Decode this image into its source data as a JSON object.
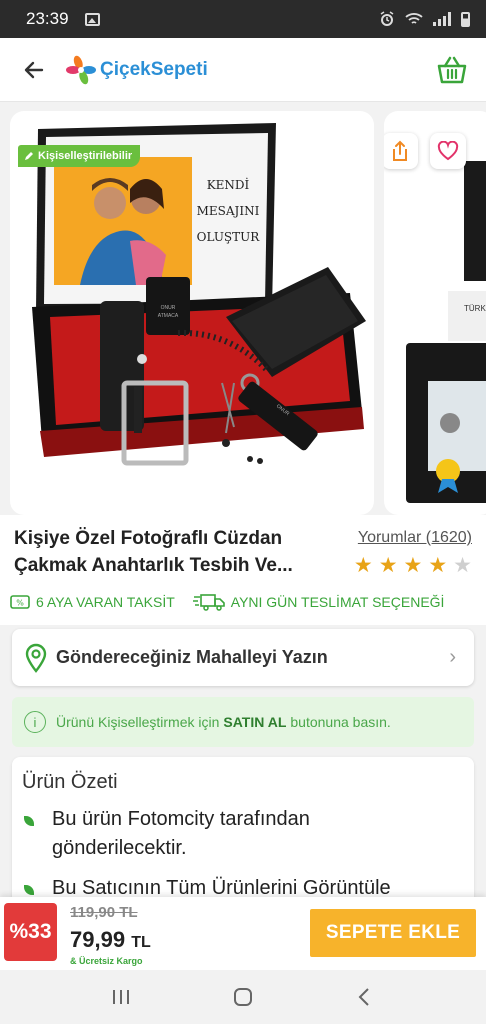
{
  "status_bar": {
    "time": "23:39"
  },
  "header": {
    "logo_text": "ÇiçekSepeti"
  },
  "gallery": {
    "badge": "Kişiselleştirilebilir",
    "card_lines": [
      "KENDİ",
      "MESAJINI",
      "OLUŞTUR"
    ],
    "engraving": [
      "ONUR",
      "ATMACA"
    ],
    "id_text": "TÜRKİ"
  },
  "product": {
    "title": "Kişiye Özel Fotoğraflı Cüzdan\nÇakmak Anahtarlık Tesbih Ve...",
    "reviews": "Yorumlar (1620)",
    "rating": 4,
    "rating_max": 5,
    "tag_installment": "6 AYA VARAN TAKSİT",
    "tag_delivery": "AYNI GÜN TESLİMAT SEÇENEĞİ"
  },
  "delivery": {
    "label": "Göndereceğiniz Mahalleyi Yazın"
  },
  "notice": {
    "icon_text": "i",
    "before": "Ürünü Kişiselleştirmek için",
    "bold": "SATIN AL",
    "after": "butonuna basın."
  },
  "summary": {
    "title": "Ürün Özeti",
    "items": [
      "Bu ürün Fotomcity tarafından gönderilecektir.",
      "Bu Satıcının Tüm Ürünlerini Görüntüle"
    ]
  },
  "purchase": {
    "discount": "%33",
    "old_price": "119,90 TL",
    "new_price": "79,99",
    "currency": "TL",
    "shipping": "& Ücretsiz Kargo",
    "add_to_cart": "SEPETE EKLE"
  },
  "colors": {
    "brand_green": "#3aa53a",
    "button_orange": "#f7b32b",
    "discount_red": "#e23a3a",
    "star_gold": "#e8a317"
  }
}
